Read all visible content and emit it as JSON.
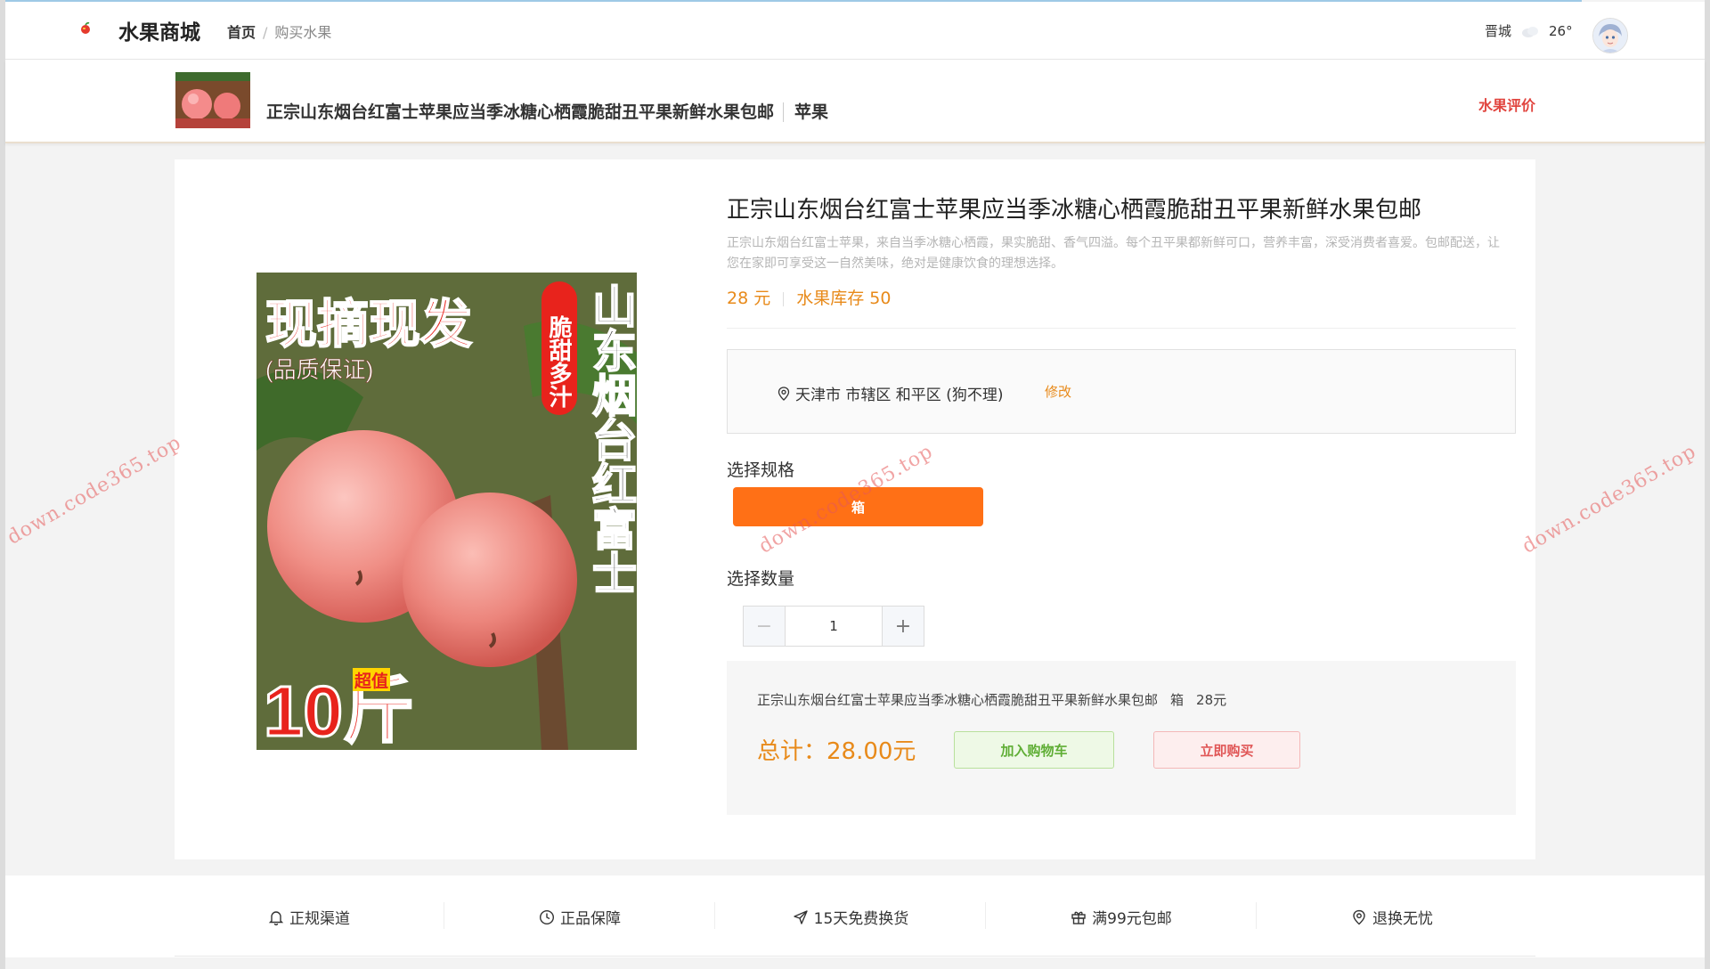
{
  "header": {
    "brand": "水果商城",
    "breadcrumb": {
      "home": "首页",
      "separator": "/",
      "current": "购买水果"
    },
    "weather": {
      "city": "晋城",
      "temperature": "26°",
      "icon": "cloudy-icon"
    }
  },
  "subheader": {
    "title": "正宗山东烟台红富士苹果应当季冰糖心栖霞脆甜丑平果新鲜水果包邮",
    "category": "苹果",
    "review_link": "水果评价"
  },
  "product": {
    "title": "正宗山东烟台红富士苹果应当季冰糖心栖霞脆甜丑平果新鲜水果包邮",
    "description": "正宗山东烟台红富士苹果，来自当季冰糖心栖霞，果实脆甜、香气四溢。每个丑平果都新鲜可口，营养丰富，深受消费者喜爱。包邮配送，让您在家即可享受这一自然美味，绝对是健康饮食的理想选择。",
    "price": "28 元",
    "stock": "水果库存 50",
    "image_text": {
      "headline": "现摘现发",
      "quality": "(品质保证)",
      "badge": "脆甜多汁",
      "vertical": "山东烟台红富士",
      "weight": "10斤",
      "value_tag": "超值"
    }
  },
  "address": {
    "text": "天津市 市辖区 和平区 (狗不理)",
    "edit_label": "修改"
  },
  "spec": {
    "label": "选择规格",
    "selected": "箱"
  },
  "quantity": {
    "label": "选择数量",
    "value": "1",
    "minus": "−",
    "plus": "+"
  },
  "summary": {
    "name": "正宗山东烟台红富士苹果应当季冰糖心栖霞脆甜丑平果新鲜水果包邮",
    "spec": "箱",
    "price": "28元",
    "total": "总计：28.00元",
    "add_to_cart": "加入购物车",
    "buy_now": "立即购买"
  },
  "features": [
    {
      "label": "正规渠道",
      "icon": "bell-icon"
    },
    {
      "label": "正品保障",
      "icon": "clock-icon"
    },
    {
      "label": "15天免费换货",
      "icon": "send-icon"
    },
    {
      "label": "满99元包邮",
      "icon": "gift-icon"
    },
    {
      "label": "退换无忧",
      "icon": "location-icon"
    }
  ],
  "watermark": "down.code365.top",
  "colors": {
    "accent_orange": "#ff7016",
    "price_orange": "#e88a1a",
    "review_red": "#e1453f",
    "cart_green": "#5fae35",
    "buy_red": "#e05656"
  }
}
